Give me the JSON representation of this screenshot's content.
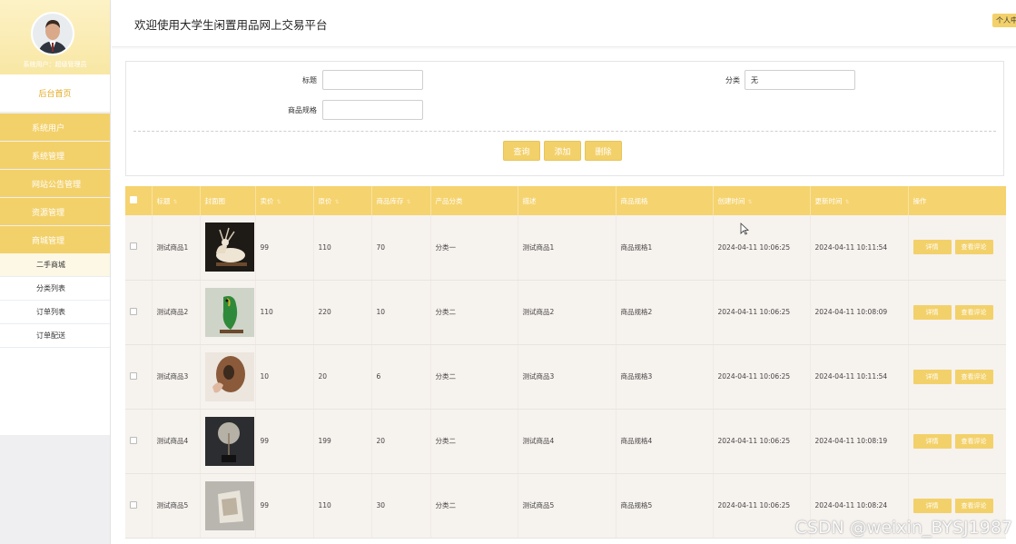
{
  "sidebar": {
    "user_text": "系统用户：超级管理员",
    "home": "后台首页",
    "menus": [
      "系统用户",
      "系统管理",
      "网站公告管理",
      "资源管理",
      "商城管理"
    ],
    "submenus": [
      "二手商城",
      "分类列表",
      "订单列表",
      "订单配送"
    ]
  },
  "header": {
    "title": "欢迎使用大学生闲置用品网上交易平台",
    "personal_center": "个人中心"
  },
  "search": {
    "title_label": "标题",
    "category_label": "分类",
    "category_value": "无",
    "spec_label": "商品规格",
    "query_btn": "查询",
    "add_btn": "添加",
    "delete_btn": "删除"
  },
  "table": {
    "headers": [
      "标题",
      "封面图",
      "卖价",
      "原价",
      "商品库存",
      "产品分类",
      "描述",
      "商品规格",
      "创建时间",
      "更新时间",
      "操作"
    ],
    "detail_btn": "详情",
    "comment_btn": "查看评论",
    "rows": [
      {
        "title": "测试商品1",
        "price": "99",
        "orig": "110",
        "stock": "70",
        "cat": "分类一",
        "desc": "测试商品1",
        "spec": "商品规格1",
        "created": "2024-04-11 10:06:25",
        "updated": "2024-04-11 10:11:54"
      },
      {
        "title": "测试商品2",
        "price": "110",
        "orig": "220",
        "stock": "10",
        "cat": "分类二",
        "desc": "测试商品2",
        "spec": "商品规格2",
        "created": "2024-04-11 10:06:25",
        "updated": "2024-04-11 10:08:09"
      },
      {
        "title": "测试商品3",
        "price": "10",
        "orig": "20",
        "stock": "6",
        "cat": "分类二",
        "desc": "测试商品3",
        "spec": "商品规格3",
        "created": "2024-04-11 10:06:25",
        "updated": "2024-04-11 10:11:54"
      },
      {
        "title": "测试商品4",
        "price": "99",
        "orig": "199",
        "stock": "20",
        "cat": "分类二",
        "desc": "测试商品4",
        "spec": "商品规格4",
        "created": "2024-04-11 10:06:25",
        "updated": "2024-04-11 10:08:19"
      },
      {
        "title": "测试商品5",
        "price": "99",
        "orig": "110",
        "stock": "30",
        "cat": "分类二",
        "desc": "测试商品5",
        "spec": "商品规格5",
        "created": "2024-04-11 10:06:25",
        "updated": "2024-04-11 10:08:24"
      }
    ]
  },
  "watermark": "CSDN @weixin_BYSJ1987",
  "colors": {
    "accent": "#f3d16a",
    "row_bg": "#f6f2ee",
    "home_text": "#e3a91e"
  }
}
